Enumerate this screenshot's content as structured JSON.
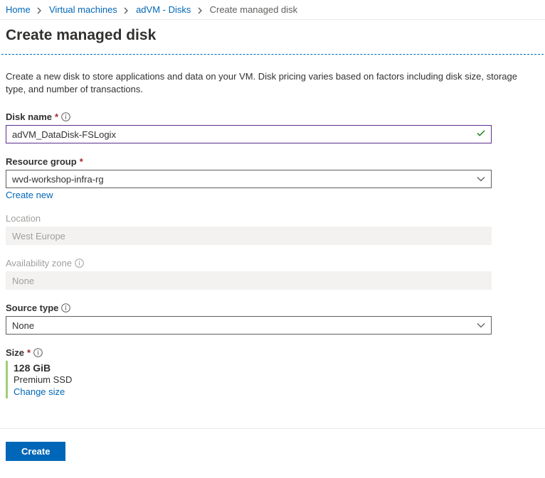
{
  "breadcrumb": {
    "home": "Home",
    "vms": "Virtual machines",
    "vm_disks": "adVM - Disks",
    "current": "Create managed disk"
  },
  "page_title": "Create managed disk",
  "intro": "Create a new disk to store applications and data on your VM. Disk pricing varies based on factors including disk size, storage type, and number of transactions.",
  "fields": {
    "disk_name": {
      "label": "Disk name",
      "value": "adVM_DataDisk-FSLogix"
    },
    "resource_group": {
      "label": "Resource group",
      "value": "wvd-workshop-infra-rg",
      "create_new": "Create new"
    },
    "location": {
      "label": "Location",
      "value": "West Europe"
    },
    "availability_zone": {
      "label": "Availability zone",
      "value": "None"
    },
    "source_type": {
      "label": "Source type",
      "value": "None"
    },
    "size": {
      "label": "Size",
      "value": "128 GiB",
      "tier": "Premium SSD",
      "change": "Change size"
    }
  },
  "buttons": {
    "create": "Create"
  }
}
